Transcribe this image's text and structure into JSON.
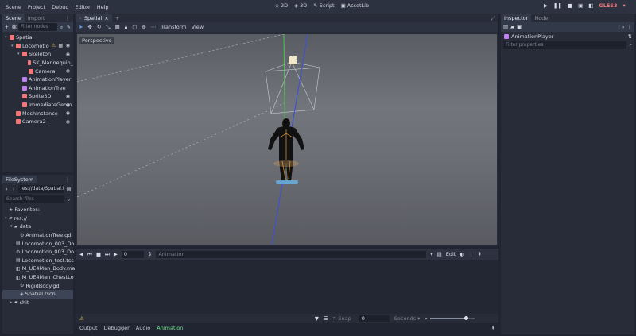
{
  "menu": [
    "Scene",
    "Project",
    "Debug",
    "Editor",
    "Help"
  ],
  "workspaces": [
    {
      "label": "2D",
      "icon": "2d-icon",
      "active": false
    },
    {
      "label": "3D",
      "icon": "3d-icon",
      "active": true
    },
    {
      "label": "Script",
      "icon": "script-icon",
      "active": false
    },
    {
      "label": "AssetLib",
      "icon": "assetlib-icon",
      "active": false
    }
  ],
  "renderer": "GLES3",
  "scene_dock": {
    "tabs": [
      "Scene",
      "Import"
    ],
    "filter_placeholder": "Filter nodes",
    "nodes": [
      {
        "name": "Spatial",
        "depth": 0,
        "icon": "spatial-icon",
        "color": "#f07878",
        "eye": false,
        "warn": false
      },
      {
        "name": "Locomotio",
        "depth": 1,
        "icon": "kinematic-body-icon",
        "color": "#f07878",
        "eye": true,
        "warn": true,
        "film": true
      },
      {
        "name": "Skeleton",
        "depth": 2,
        "icon": "skeleton-icon",
        "color": "#f07878",
        "eye": true
      },
      {
        "name": "SK_Mannequin_",
        "depth": 3,
        "icon": "mesh-icon",
        "color": "#f07878",
        "eye": false
      },
      {
        "name": "Camera",
        "depth": 3,
        "icon": "camera-icon",
        "color": "#f07878",
        "eye": true
      },
      {
        "name": "AnimationPlayer",
        "depth": 2,
        "icon": "animation-player-icon",
        "color": "#c080f0",
        "eye": false
      },
      {
        "name": "AnimationTree",
        "depth": 2,
        "icon": "animation-tree-icon",
        "color": "#c080f0",
        "eye": false
      },
      {
        "name": "Sprite3D",
        "depth": 2,
        "icon": "sprite3d-icon",
        "color": "#f07878",
        "eye": true
      },
      {
        "name": "ImmediateGeom",
        "depth": 2,
        "icon": "immediate-geometry-icon",
        "color": "#f07878",
        "eye": true
      },
      {
        "name": "MeshInstance",
        "depth": 1,
        "icon": "mesh-instance-icon",
        "color": "#f07878",
        "eye": true
      },
      {
        "name": "Camera2",
        "depth": 1,
        "icon": "camera-icon",
        "color": "#f07878",
        "eye": true
      }
    ]
  },
  "filesystem": {
    "tab": "FileSystem",
    "path": "res://data/Spatial.t",
    "search_placeholder": "Search files",
    "items": [
      {
        "name": "Favorites:",
        "depth": 0,
        "icon": "star-icon",
        "selected": false
      },
      {
        "name": "res://",
        "depth": 0,
        "icon": "folder-icon",
        "selected": false
      },
      {
        "name": "data",
        "depth": 1,
        "icon": "folder-icon",
        "selected": false
      },
      {
        "name": "AnimationTree.gd",
        "depth": 2,
        "icon": "gear-icon",
        "selected": false
      },
      {
        "name": "Locomotion_003_Do",
        "depth": 2,
        "icon": "file-icon",
        "selected": false
      },
      {
        "name": "Locomotion_003_Do",
        "depth": 2,
        "icon": "gear-icon",
        "selected": false
      },
      {
        "name": "Locomotion_test.tsc",
        "depth": 2,
        "icon": "file-icon",
        "selected": false
      },
      {
        "name": "M_UE4Man_Body.ma",
        "depth": 2,
        "icon": "material-icon",
        "selected": false
      },
      {
        "name": "M_UE4Man_ChestLo",
        "depth": 2,
        "icon": "material-icon",
        "selected": false
      },
      {
        "name": "RigidBody.gd",
        "depth": 2,
        "icon": "gear-icon",
        "selected": false
      },
      {
        "name": "Spatial.tscn",
        "depth": 2,
        "icon": "scene-icon",
        "selected": true
      },
      {
        "name": "shit",
        "depth": 1,
        "icon": "folder-icon",
        "selected": false
      }
    ]
  },
  "viewport": {
    "tab": "Spatial",
    "toolbar": [
      "Transform",
      "View"
    ],
    "perspective_label": "Perspective"
  },
  "animation": {
    "frame": "0",
    "anim_placeholder": "Animation",
    "edit_label": "Edit",
    "snap_label": "Snap",
    "snap_value": "0",
    "time_unit": "Seconds",
    "zoom_fraction": 0.82
  },
  "bottom_tabs": [
    {
      "label": "Output",
      "selected": false
    },
    {
      "label": "Debugger",
      "selected": false
    },
    {
      "label": "Audio",
      "selected": false
    },
    {
      "label": "Animation",
      "selected": true
    }
  ],
  "inspector": {
    "tabs": [
      "Inspector",
      "Node"
    ],
    "object_name": "AnimationPlayer",
    "filter_placeholder": "Filter properties"
  }
}
